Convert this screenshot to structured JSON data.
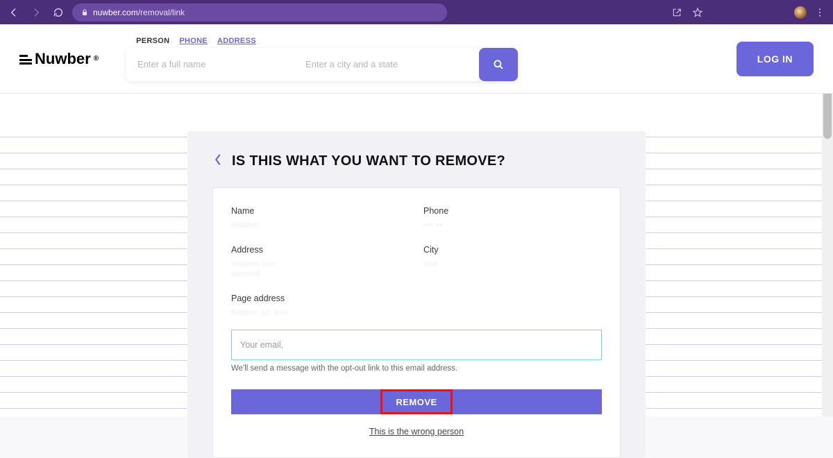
{
  "browser": {
    "url_host": "nuwber.com",
    "url_path": "/removal/link"
  },
  "header": {
    "logo_text": "Nuwber",
    "tabs": {
      "person": "PERSON",
      "phone": "PHONE",
      "address": "ADDRESS"
    },
    "name_placeholder": "Enter a full name",
    "city_placeholder": "Enter a city and a state",
    "login_label": "LOG IN"
  },
  "card": {
    "title": "IS THIS WHAT YOU WANT TO REMOVE?",
    "labels": {
      "name": "Name",
      "phone": "Phone",
      "address": "Address",
      "city": "City",
      "page_address": "Page address"
    },
    "email_placeholder": "Your email,",
    "helper_text": "We'll send a message with the opt-out link to this email address.",
    "remove_label": "REMOVE",
    "wrong_person_label": "This is the wrong person"
  }
}
